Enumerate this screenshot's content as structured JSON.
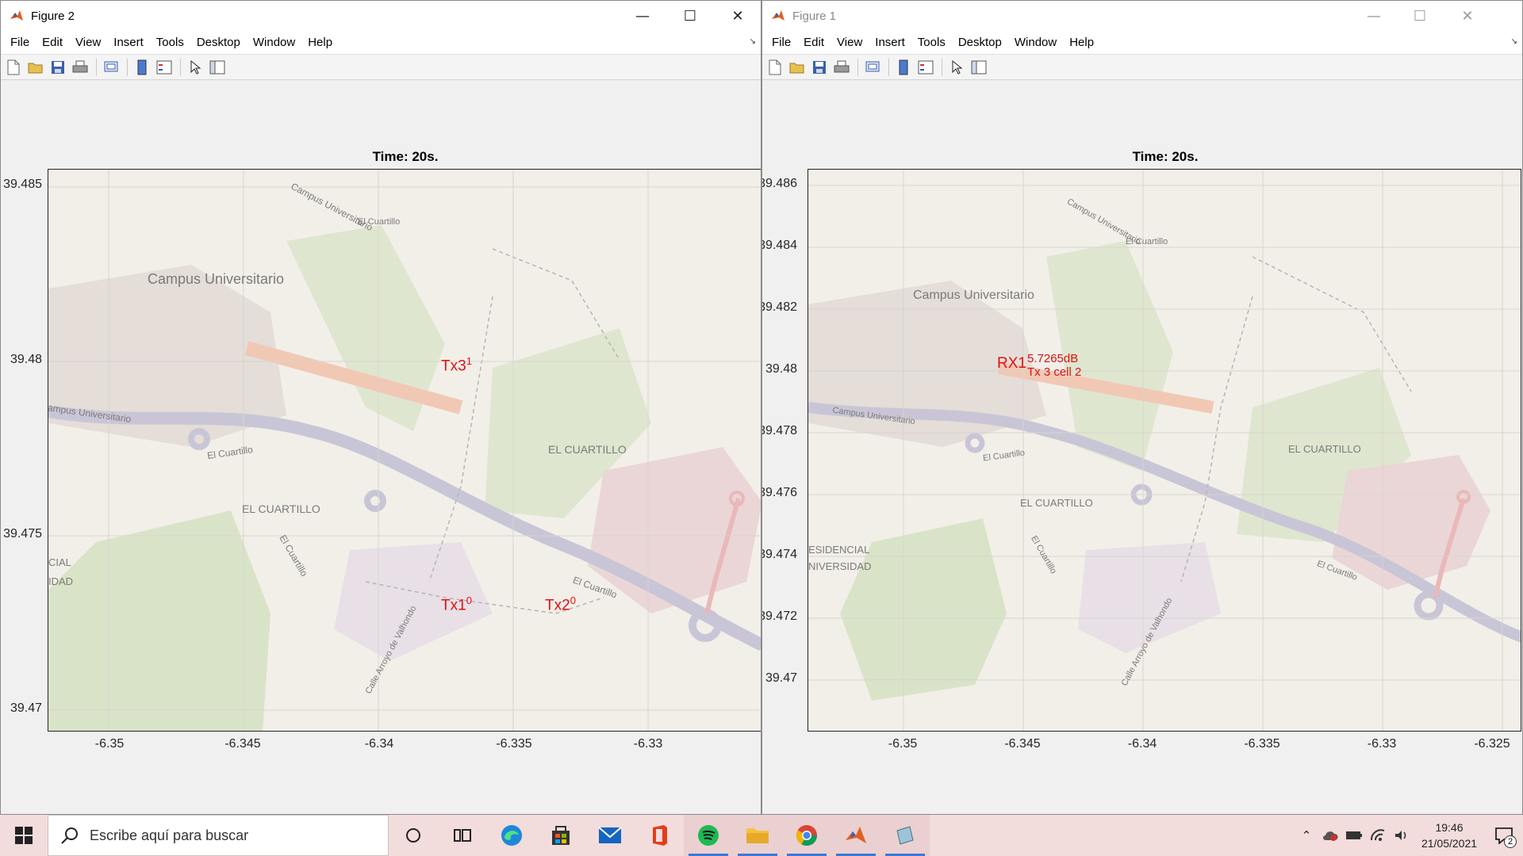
{
  "windows": [
    {
      "id": "figure2",
      "title": "Figure 2",
      "active": true,
      "menu": [
        "File",
        "Edit",
        "View",
        "Insert",
        "Tools",
        "Desktop",
        "Window",
        "Help"
      ],
      "axes_title": "Time: 20s.",
      "y_ticks": [
        "39.485",
        "39.48",
        "39.475",
        "39.47"
      ],
      "x_ticks": [
        "-6.35",
        "-6.345",
        "-6.34",
        "-6.335",
        "-6.33"
      ],
      "map_labels": [
        "Campus Universitario",
        "Campus Universitario",
        "Campus Universitario",
        "El Cuartillo",
        "El Cuartillo",
        "EL CUARTILLO",
        "EL CUARTILLO",
        "El Cuartillo",
        "El Cuartillo",
        "CIAL",
        "IDAD",
        "Calle Arroyo de Valhondo"
      ],
      "transmitters": [
        {
          "label": "Tx3",
          "sup": "1"
        },
        {
          "label": "Tx1",
          "sup": "0"
        },
        {
          "label": "Tx2",
          "sup": "0"
        }
      ]
    },
    {
      "id": "figure1",
      "title": "Figure 1",
      "active": false,
      "menu": [
        "File",
        "Edit",
        "View",
        "Insert",
        "Tools",
        "Desktop",
        "Window",
        "Help"
      ],
      "axes_title": "Time: 20s.",
      "y_ticks": [
        "39.486",
        "39.484",
        "39.482",
        "39.48",
        "39.478",
        "39.476",
        "39.474",
        "39.472",
        "39.47"
      ],
      "x_ticks": [
        "-6.35",
        "-6.345",
        "-6.34",
        "-6.335",
        "-6.33",
        "-6.325"
      ],
      "map_labels": [
        "Campus Universitario",
        "Campus Universitario",
        "Campus Universitario",
        "El Cuartillo",
        "El Cuartillo",
        "EL CUARTILLO",
        "EL CUARTILLO",
        "El Cuartillo",
        "El Cuartillo",
        "ESIDENCIAL",
        "NIVERSIDAD",
        "Calle Arroyo de Valhondo"
      ],
      "receiver": {
        "label": "RX1",
        "power": "5.7265dB",
        "serving": "Tx 3 cell 2"
      }
    }
  ],
  "taskbar": {
    "search_placeholder": "Escribe aquí para buscar",
    "apps": [
      "cortana-icon",
      "task-view-icon",
      "edge-icon",
      "store-icon",
      "mail-icon",
      "office-icon",
      "spotify-icon",
      "file-explorer-icon",
      "chrome-icon",
      "matlab-icon",
      "matlab-figure-icon"
    ],
    "time": "19:46",
    "date": "21/05/2021",
    "notification_count": "2"
  },
  "colors": {
    "marker_red": "#e01010",
    "map_bg": "#f2efe9",
    "road": "#c8c6d6",
    "park": "#d9e3c8",
    "taskbar": "#f2dcdc"
  }
}
